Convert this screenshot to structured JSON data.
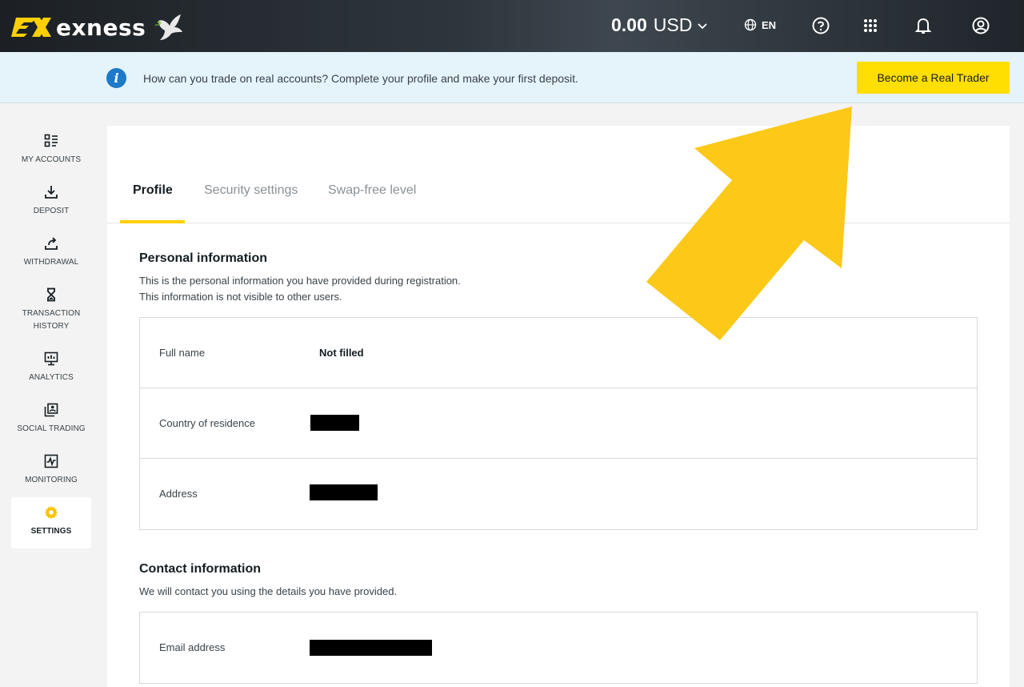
{
  "header": {
    "brand": "exness",
    "balance_amount": "0.00",
    "balance_currency": "USD",
    "language": "EN"
  },
  "banner": {
    "message": "How can you trade on real accounts? Complete your profile and make your first deposit.",
    "cta_label": "Become a Real Trader"
  },
  "sidebar": {
    "items": [
      {
        "label": "MY ACCOUNTS",
        "icon": "accounts-grid-icon"
      },
      {
        "label": "DEPOSIT",
        "icon": "download-arrow-icon"
      },
      {
        "label": "WITHDRAWAL",
        "icon": "upload-arrow-icon"
      },
      {
        "label": "TRANSACTION HISTORY",
        "icon": "hourglass-icon"
      },
      {
        "label": "ANALYTICS",
        "icon": "chart-board-icon"
      },
      {
        "label": "SOCIAL TRADING",
        "icon": "social-trading-icon"
      },
      {
        "label": "MONITORING",
        "icon": "monitoring-icon"
      },
      {
        "label": "SETTINGS",
        "icon": "gear-icon",
        "active": true
      }
    ]
  },
  "tabs": [
    {
      "label": "Profile",
      "active": true
    },
    {
      "label": "Security settings"
    },
    {
      "label": "Swap-free level"
    }
  ],
  "personal": {
    "title": "Personal information",
    "desc_line1": "This is the personal information you have provided during registration.",
    "desc_line2": "This information is not visible to other users.",
    "rows": [
      {
        "label": "Full name",
        "value": "Not filled"
      },
      {
        "label": "Country of residence",
        "value": ""
      },
      {
        "label": "Address",
        "value": ""
      }
    ]
  },
  "contact": {
    "title": "Contact information",
    "desc": "We will contact you using the details you have provided.",
    "rows": [
      {
        "label": "Email address",
        "value": ""
      }
    ]
  },
  "colors": {
    "accent_yellow": "#ffde02",
    "arrow_yellow": "#fcc918",
    "banner_bg": "#e5f3fb",
    "info_blue": "#1c7ac9"
  }
}
